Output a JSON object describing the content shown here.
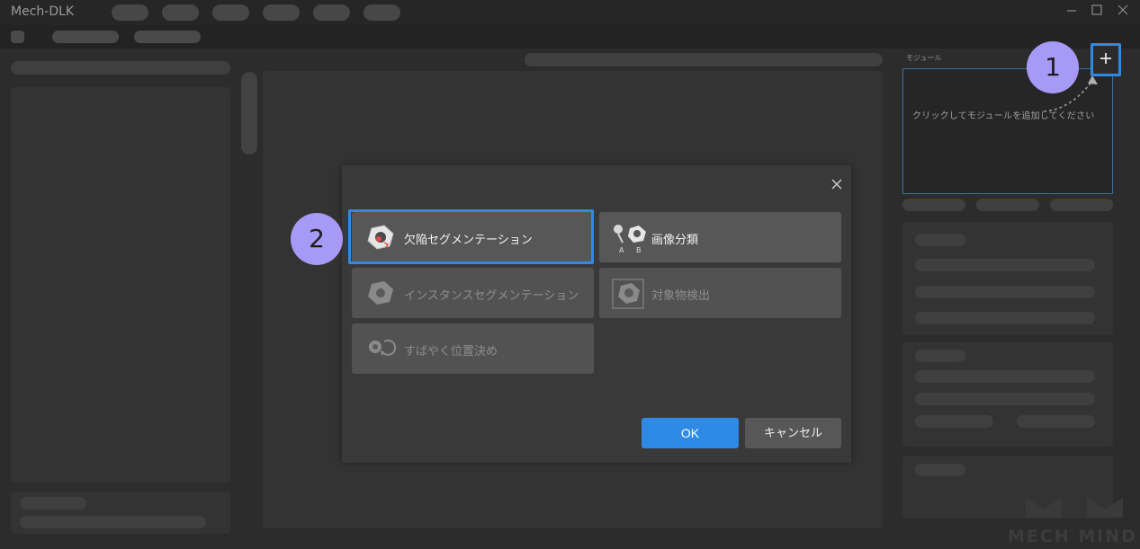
{
  "app": {
    "title": "Mech-DLK"
  },
  "window": {
    "minimize_icon": "minimize-icon",
    "maximize_icon": "maximize-icon",
    "close_icon": "close-icon"
  },
  "right_panel": {
    "module_title": "モジュール",
    "hint": "クリックしてモジュールを追加してください",
    "add_icon": "plus-icon"
  },
  "callouts": {
    "one": "1",
    "two": "2"
  },
  "dialog": {
    "close_icon": "close-icon",
    "options": [
      {
        "label": "欠陥セグメンテーション",
        "icon": "defect-segmentation-icon",
        "enabled": true,
        "selected": true
      },
      {
        "label": "画像分類",
        "icon": "image-classification-icon",
        "enabled": true,
        "selected": false
      },
      {
        "label": "インスタンスセグメンテーション",
        "icon": "instance-segmentation-icon",
        "enabled": false,
        "selected": false
      },
      {
        "label": "対象物検出",
        "icon": "object-detection-icon",
        "enabled": false,
        "selected": false
      },
      {
        "label": "すばやく位置決め",
        "icon": "fast-positioning-icon",
        "enabled": false,
        "selected": false
      }
    ],
    "ab_labels": [
      "A",
      "B"
    ],
    "ok_label": "OK",
    "cancel_label": "キャンセル"
  },
  "watermark": "MECH MIND",
  "colors": {
    "accent": "#2f8ae6",
    "callout": "#a79af6",
    "background": "#2c2c2c"
  }
}
